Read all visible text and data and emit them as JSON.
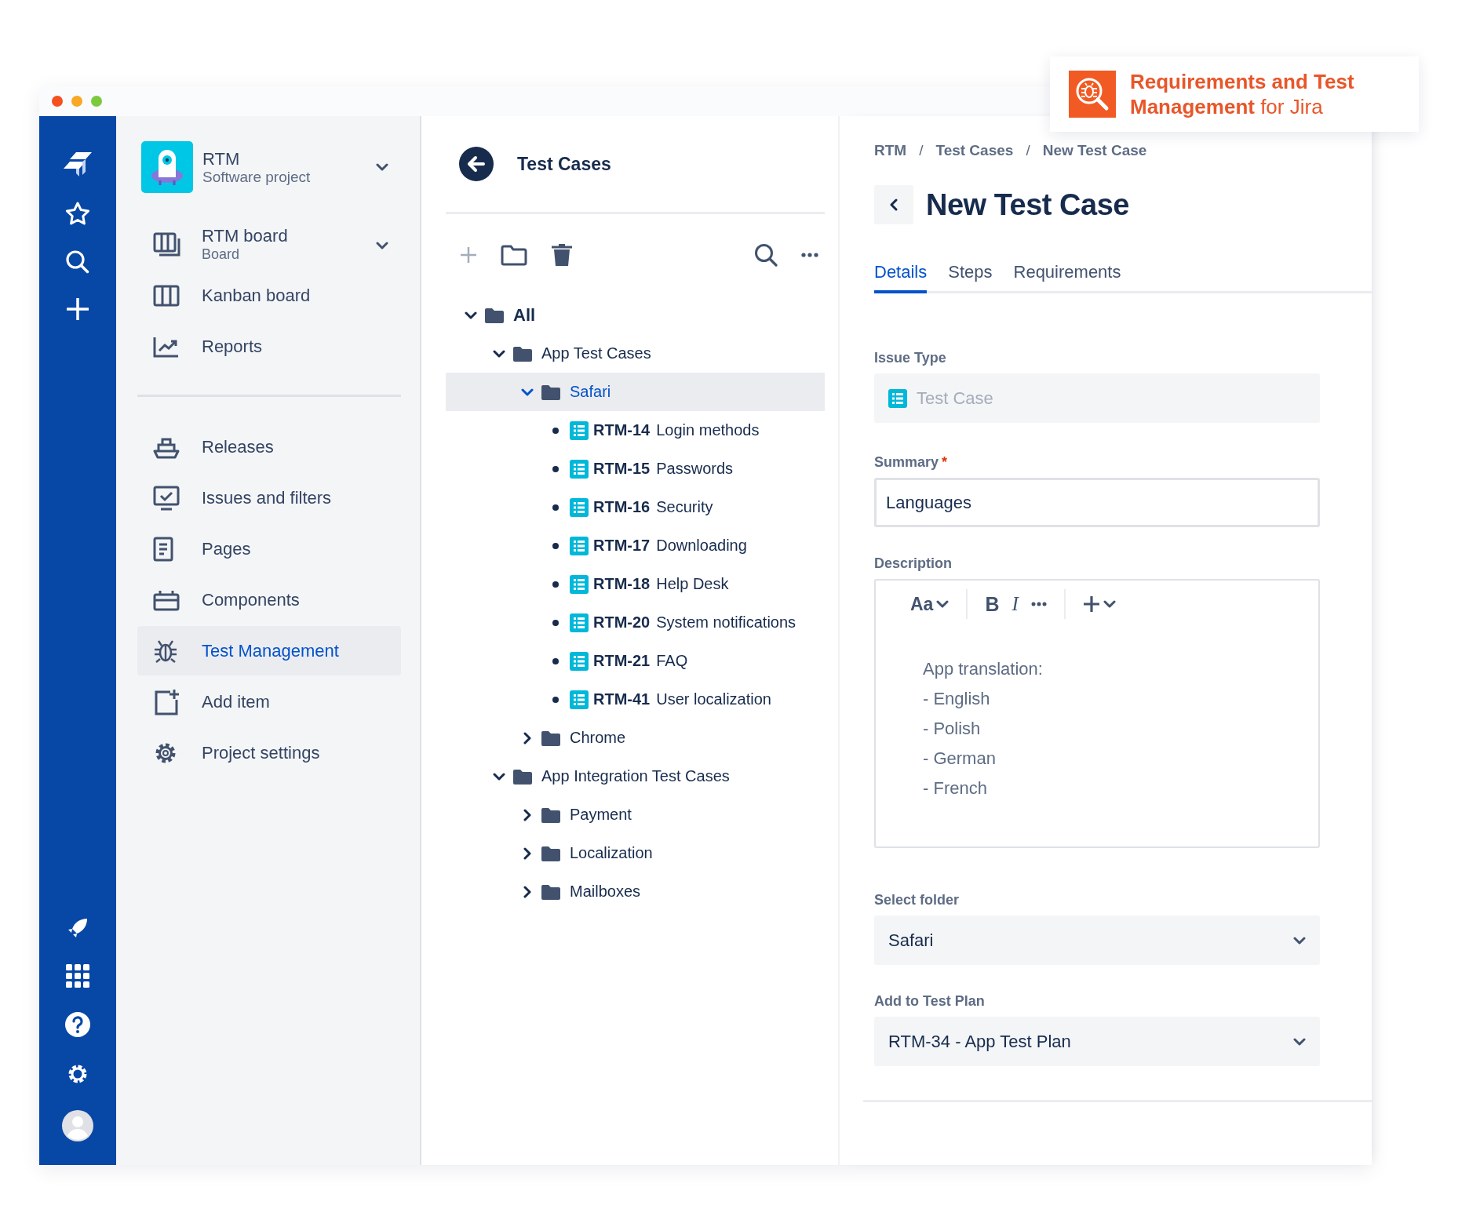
{
  "badge": {
    "text": "**Requirements and Test Management** for Jira"
  },
  "project": {
    "name": "RTM",
    "type": "Software project"
  },
  "sidebar": {
    "top_items": [
      {
        "label": "RTM board",
        "sublabel": "Board",
        "dropdown": true,
        "selected": false
      },
      {
        "label": "Kanban board",
        "selected": false
      },
      {
        "label": "Reports",
        "selected": false
      }
    ],
    "items": [
      {
        "label": "Releases",
        "selected": false
      },
      {
        "label": "Issues and filters",
        "selected": false
      },
      {
        "label": "Pages",
        "selected": false
      },
      {
        "label": "Components",
        "selected": false
      },
      {
        "label": "Test Management",
        "selected": true
      },
      {
        "label": "Add item",
        "selected": false
      },
      {
        "label": "Project settings",
        "selected": false
      }
    ]
  },
  "test_cases": {
    "title": "Test Cases",
    "tree": [
      {
        "kind": "folder",
        "label": "All",
        "expanded": true,
        "selected": false,
        "children": [
          {
            "kind": "folder",
            "label": "App Test Cases",
            "expanded": true,
            "selected": false,
            "children": [
              {
                "kind": "folder",
                "label": "Safari",
                "expanded": true,
                "selected": true,
                "children": [
                  {
                    "kind": "case",
                    "key": "RTM-14",
                    "title": "Login methods"
                  },
                  {
                    "kind": "case",
                    "key": "RTM-15",
                    "title": "Passwords"
                  },
                  {
                    "kind": "case",
                    "key": "RTM-16",
                    "title": "Security"
                  },
                  {
                    "kind": "case",
                    "key": "RTM-17",
                    "title": "Downloading"
                  },
                  {
                    "kind": "case",
                    "key": "RTM-18",
                    "title": "Help Desk"
                  },
                  {
                    "kind": "case",
                    "key": "RTM-20",
                    "title": "System notifications"
                  },
                  {
                    "kind": "case",
                    "key": "RTM-21",
                    "title": "FAQ"
                  },
                  {
                    "kind": "case",
                    "key": "RTM-41",
                    "title": "User localization"
                  }
                ]
              },
              {
                "kind": "folder",
                "label": "Chrome",
                "expanded": false,
                "selected": false
              }
            ]
          },
          {
            "kind": "folder",
            "label": "App Integration Test Cases",
            "expanded": true,
            "selected": false,
            "children": [
              {
                "kind": "folder",
                "label": "Payment",
                "expanded": false,
                "selected": false
              },
              {
                "kind": "folder",
                "label": "Localization",
                "expanded": false,
                "selected": false
              },
              {
                "kind": "folder",
                "label": "Mailboxes",
                "expanded": false,
                "selected": false
              }
            ]
          }
        ]
      }
    ]
  },
  "breadcrumbs": {
    "items": [
      "RTM",
      "Test Cases",
      "New Test Case"
    ],
    "separators": [
      "/",
      "/"
    ]
  },
  "title": "New Test Case",
  "tabs": [
    {
      "label": "Details",
      "selected": true
    },
    {
      "label": "Steps",
      "selected": false
    },
    {
      "label": "Requirements",
      "selected": false
    }
  ],
  "form": {
    "issue_type": {
      "label": "Issue Type",
      "value": "Test Case",
      "disabled": true
    },
    "summary": {
      "label": "Summary",
      "required_mark": "*",
      "value": "Languages"
    },
    "description": {
      "label": "Description",
      "toolbar": [
        {
          "kind": "style",
          "text": "Aa"
        },
        {
          "kind": "bold",
          "text": "B"
        },
        {
          "kind": "italic",
          "text": "I"
        }
      ],
      "lines": [
        "App translation:",
        "- English",
        "- Polish",
        "- German",
        "- French"
      ]
    },
    "folder": {
      "label": "Select folder",
      "value": "Safari"
    },
    "test_plan": {
      "label": "Add to Test Plan",
      "value": "RTM-34 - App Test Plan"
    }
  }
}
